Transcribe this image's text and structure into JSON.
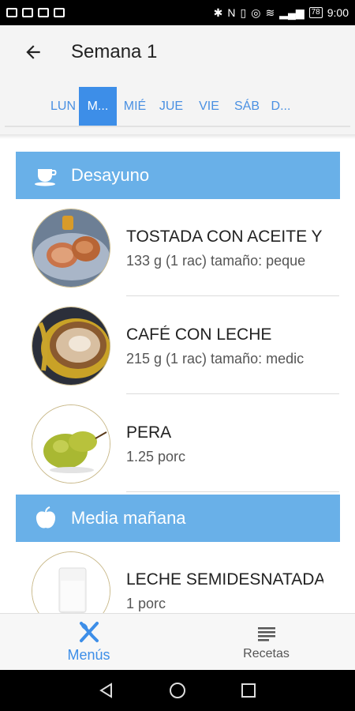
{
  "status_bar": {
    "time": "9:00",
    "battery": "78"
  },
  "header": {
    "title": "Semana 1"
  },
  "day_tabs": [
    {
      "label": "LUN"
    },
    {
      "label": "M..."
    },
    {
      "label": "MIÉ"
    },
    {
      "label": "JUE"
    },
    {
      "label": "VIE"
    },
    {
      "label": "SÁB"
    },
    {
      "label": "D..."
    }
  ],
  "active_tab_index": 1,
  "sections": [
    {
      "label": "Desayuno",
      "icon": "coffee-cup-icon",
      "items": [
        {
          "name": "TOSTADA CON ACEITE Y",
          "detail": "133 g (1 rac) tamaño: peque"
        },
        {
          "name": "CAFÉ CON LECHE",
          "detail": "215 g (1 rac) tamaño: medic"
        },
        {
          "name": "PERA",
          "detail": "1.25 porc"
        }
      ]
    },
    {
      "label": "Media mañana",
      "icon": "apple-icon",
      "items": [
        {
          "name": "LECHE SEMIDESNATADA",
          "detail": "1 porc"
        }
      ]
    }
  ],
  "bottom_nav": {
    "menus_label": "Menús",
    "recetas_label": "Recetas"
  },
  "colors": {
    "accent": "#3d8ee8",
    "section_bg": "#69b0e8"
  }
}
